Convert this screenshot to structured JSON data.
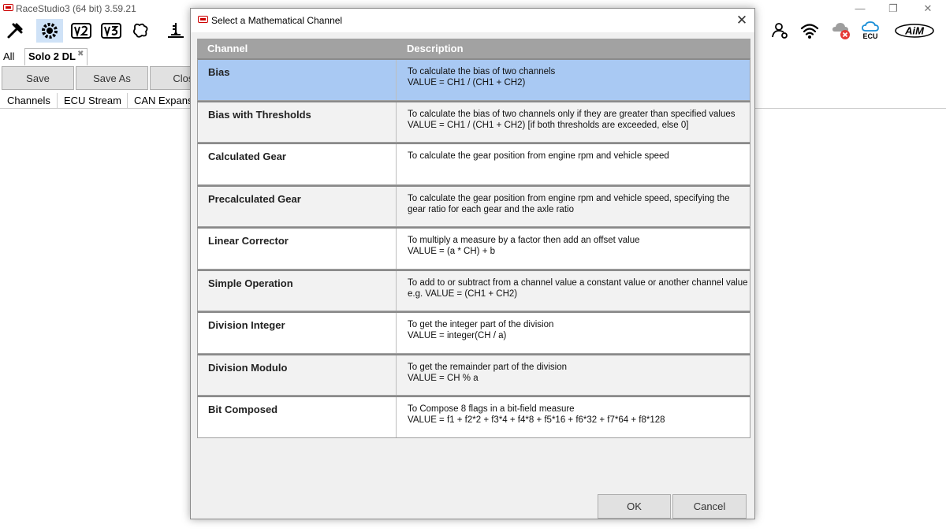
{
  "window": {
    "title": "RaceStudio3 (64 bit) 3.59.21"
  },
  "toolbar": {
    "right_ecu_label": "ECU",
    "brand": "AiM"
  },
  "tabs": {
    "all": "All",
    "device": "Solo 2 DL"
  },
  "main_buttons": {
    "save": "Save",
    "save_as": "Save As",
    "close": "Close"
  },
  "subtabs": [
    "Channels",
    "ECU Stream",
    "CAN Expansions"
  ],
  "dialog": {
    "title": "Select a Mathematical Channel",
    "columns": {
      "channel": "Channel",
      "description": "Description"
    },
    "rows": [
      {
        "channel": "Bias",
        "line1": "To calculate the bias of two channels",
        "line2": "VALUE = CH1 / (CH1 + CH2)"
      },
      {
        "channel": "Bias with Thresholds",
        "line1": "To calculate the bias of two channels only if they are greater than specified values",
        "line2": "VALUE = CH1 / (CH1 + CH2) [if both thresholds are exceeded, else 0]"
      },
      {
        "channel": "Calculated Gear",
        "line1": "To calculate the gear position from engine rpm and vehicle speed",
        "line2": ""
      },
      {
        "channel": "Precalculated Gear",
        "line1": "To calculate the gear position from engine rpm and vehicle speed, specifying the",
        "line2": "gear ratio for each gear and the axle ratio"
      },
      {
        "channel": "Linear Corrector",
        "line1": "To multiply a measure by a factor then add an offset value",
        "line2": "VALUE = (a * CH) + b"
      },
      {
        "channel": "Simple Operation",
        "line1": "To add to or subtract from a channel value a constant value or another channel value",
        "line2": "e.g. VALUE = (CH1 + CH2)"
      },
      {
        "channel": "Division Integer",
        "line1": "To get the integer part of the division",
        "line2": "VALUE = integer(CH / a)"
      },
      {
        "channel": "Division Modulo",
        "line1": "To get the remainder part of the division",
        "line2": "VALUE = CH % a"
      },
      {
        "channel": "Bit Composed",
        "line1": "To Compose 8 flags in a bit-field measure",
        "line2": "VALUE = f1 + f2*2 + f3*4 + f4*8 + f5*16 + f6*32 + f7*64 + f8*128"
      }
    ],
    "ok": "OK",
    "cancel": "Cancel"
  },
  "colors": {
    "selected_row": "#a9c9f3",
    "header": "#a2a2a2",
    "active_tool": "#cfe2f7",
    "cloud_blue": "#1a8fd8",
    "error_red": "#e53935"
  }
}
